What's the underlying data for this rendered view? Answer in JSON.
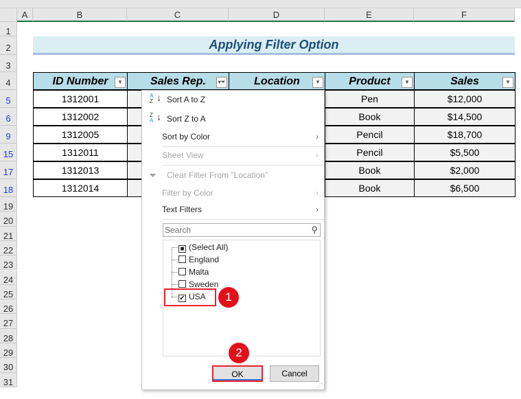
{
  "columns": [
    "A",
    "B",
    "C",
    "D",
    "E",
    "F"
  ],
  "rows": [
    "1",
    "2",
    "3",
    "4",
    "5",
    "6",
    "9",
    "15",
    "17",
    "18",
    "19",
    "20",
    "21",
    "22",
    "23",
    "24",
    "25",
    "26",
    "27",
    "28",
    "29",
    "30",
    "31"
  ],
  "title": "Applying Filter Option",
  "table": {
    "headers": [
      "ID Number",
      "Sales Rep.",
      "Location",
      "Product",
      "Sales"
    ],
    "rows": [
      {
        "id": "1312001",
        "product": "Pen",
        "sales": "$12,000"
      },
      {
        "id": "1312002",
        "product": "Book",
        "sales": "$14,500"
      },
      {
        "id": "1312005",
        "product": "Pencil",
        "sales": "$18,700"
      },
      {
        "id": "1312011",
        "product": "Pencil",
        "sales": "$5,500"
      },
      {
        "id": "1312013",
        "product": "Book",
        "sales": "$2,000"
      },
      {
        "id": "1312014",
        "product": "Book",
        "sales": "$6,500"
      }
    ]
  },
  "menu": {
    "sort_az": "Sort A to Z",
    "sort_za": "Sort Z to A",
    "sort_by_color": "Sort by Color",
    "sheet_view": "Sheet View",
    "clear_filter": "Clear Filter From \"Location\"",
    "filter_by_color": "Filter by Color",
    "text_filters": "Text Filters",
    "search_placeholder": "Search",
    "items": [
      {
        "label": "(Select All)",
        "state": "indeterminate"
      },
      {
        "label": "England",
        "state": "unchecked"
      },
      {
        "label": "Malta",
        "state": "unchecked"
      },
      {
        "label": "Sweden",
        "state": "unchecked"
      },
      {
        "label": "USA",
        "state": "checked"
      }
    ],
    "ok": "OK",
    "cancel": "Cancel"
  },
  "annotations": {
    "step1": "1",
    "step2": "2"
  },
  "colors": {
    "header_fill": "#b7dde8",
    "title_fill": "#daeef3",
    "title_text": "#1f4e79",
    "highlight": "#e8212e",
    "filtered_row_number": "#1a3cff"
  }
}
